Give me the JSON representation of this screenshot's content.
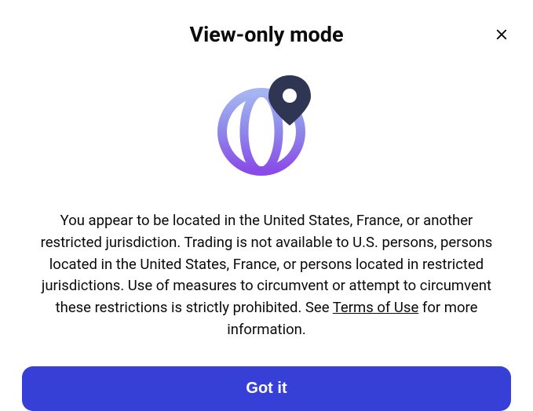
{
  "modal": {
    "title": "View-only mode",
    "body_prefix": "You appear to be located in the United States, France, or another restricted jurisdiction. Trading is not available to U.S. persons, persons located in the United States, France, or persons located in restricted jurisdictions. Use of measures to circumvent or attempt to circumvent these restrictions is strictly prohibited. See ",
    "link_text": "Terms of Use",
    "body_suffix": " for more information.",
    "button_label": "Got it"
  }
}
